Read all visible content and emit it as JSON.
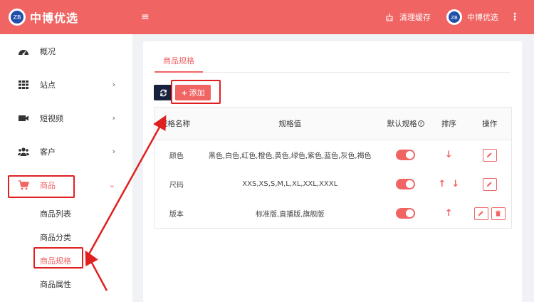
{
  "brand": {
    "name": "中博优选",
    "logo_text": "ZB"
  },
  "topbar": {
    "menu_icon": "≡",
    "cache_label": "清理缓存",
    "user_name": "中博优选",
    "more_icon": "⋮"
  },
  "sidebar": {
    "items": [
      {
        "label": "概况",
        "icon": "dashboard-icon",
        "chevron": ""
      },
      {
        "label": "站点",
        "icon": "grid-icon",
        "chevron": "›"
      },
      {
        "label": "短视频",
        "icon": "video-icon",
        "chevron": "›"
      },
      {
        "label": "客户",
        "icon": "users-icon",
        "chevron": "›"
      },
      {
        "label": "商品",
        "icon": "cart-icon",
        "chevron": "⌄"
      }
    ],
    "subitems": [
      {
        "label": "商品列表"
      },
      {
        "label": "商品分类"
      },
      {
        "label": "商品规格"
      },
      {
        "label": "商品属性"
      }
    ]
  },
  "main": {
    "tab_label": "商品规格",
    "add_label": "添加",
    "add_plus": "+",
    "table": {
      "headers": [
        "规格名称",
        "规格值",
        "默认规格",
        "排序",
        "操作"
      ],
      "help_glyph": "?",
      "rows": [
        {
          "name": "颜色",
          "values": "黑色,白色,红色,橙色,黄色,绿色,紫色,蓝色,灰色,褐色",
          "sort": [
            "↓"
          ]
        },
        {
          "name": "尺码",
          "values": "XXS,XS,S,M,L,XL,XXL,XXXL",
          "sort": [
            "↑",
            "↓"
          ]
        },
        {
          "name": "版本",
          "values": "标准版,直播版,旗舰版",
          "sort": [
            "↑"
          ]
        }
      ]
    }
  },
  "colors": {
    "primary": "#f06464",
    "dark": "#17233d",
    "annotation": "#e02020"
  }
}
